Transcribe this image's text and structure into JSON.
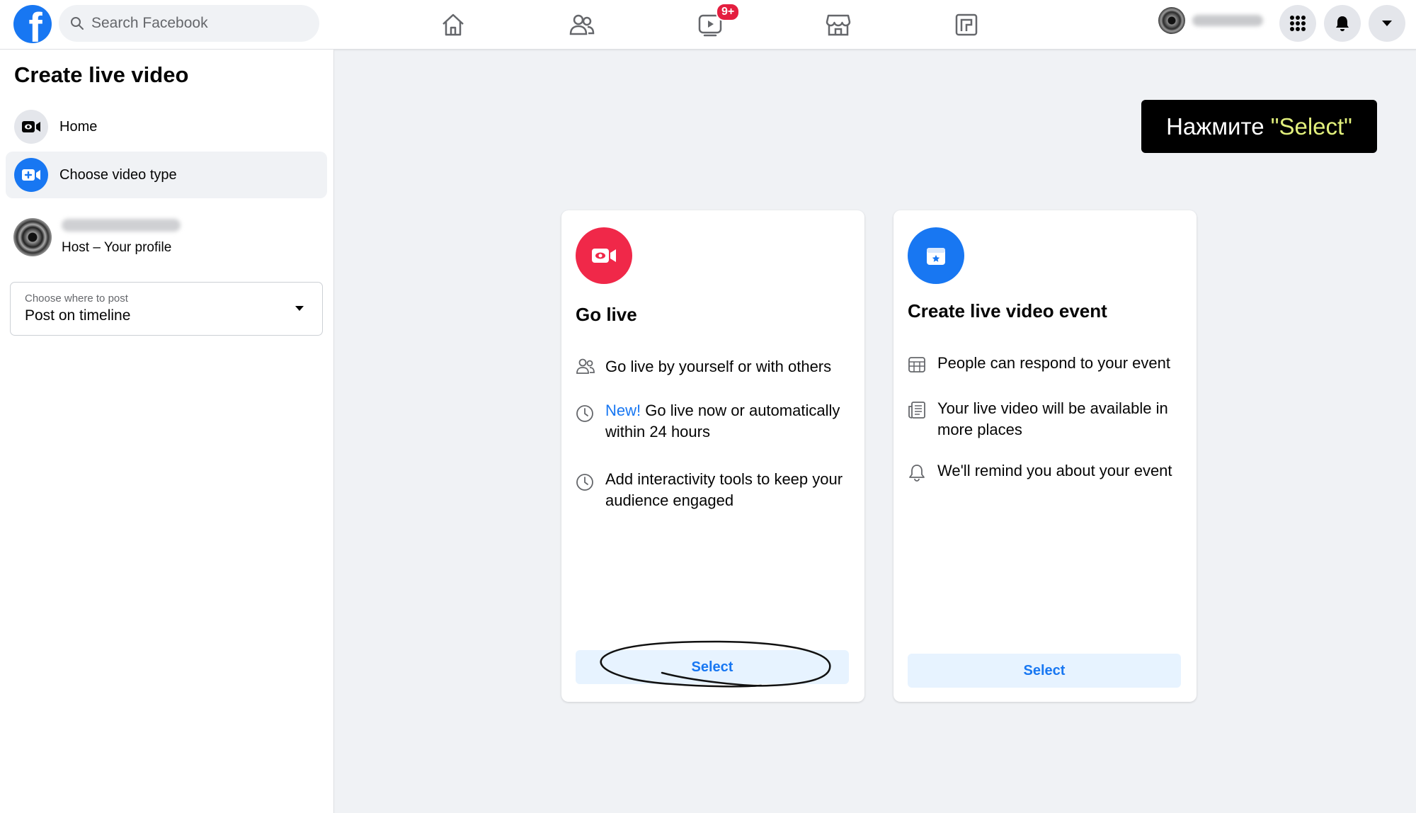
{
  "topbar": {
    "logo_icon": "facebook-logo-icon",
    "search_placeholder": "Search Facebook",
    "nav_icons": [
      "home-icon",
      "friends-icon",
      "watch-icon",
      "marketplace-icon",
      "pages-icon"
    ],
    "watch_badge": "9+",
    "account_icons": [
      "menu-grid-icon",
      "notifications-icon",
      "account-caret-icon"
    ]
  },
  "sidebar": {
    "title": "Create live video",
    "items": [
      {
        "label": "Home",
        "icon": "video-camera-icon"
      },
      {
        "label": "Choose video type",
        "icon": "add-video-icon"
      }
    ],
    "host_label": "Host – Your profile",
    "post_select": {
      "caption": "Choose where to post",
      "value": "Post on timeline"
    }
  },
  "callout": {
    "prefix": "Нажмите ",
    "highlight": "\"Select\""
  },
  "cards": [
    {
      "title": "Go live",
      "features": [
        {
          "icon": "people-icon",
          "new": "",
          "text": "Go live by yourself or with others"
        },
        {
          "icon": "clock-icon",
          "new": "New!",
          "text": " Go live now or automatically within 24 hours"
        },
        {
          "icon": "clock-icon",
          "new": "",
          "text": "Add interactivity tools to keep your audience engaged"
        }
      ],
      "button": "Select"
    },
    {
      "title": "Create live video event",
      "features": [
        {
          "icon": "calendar-grid-icon",
          "text": "People can respond to your event"
        },
        {
          "icon": "newspaper-icon",
          "text": "Your live video will be available in more places"
        },
        {
          "icon": "bell-icon",
          "text": "We'll remind you about your event"
        }
      ],
      "button": "Select"
    }
  ],
  "colors": {
    "brand": "#1877f2",
    "live_red": "#f02849",
    "select_bg": "#e7f3ff",
    "callout_highlight": "#e2f07c"
  }
}
